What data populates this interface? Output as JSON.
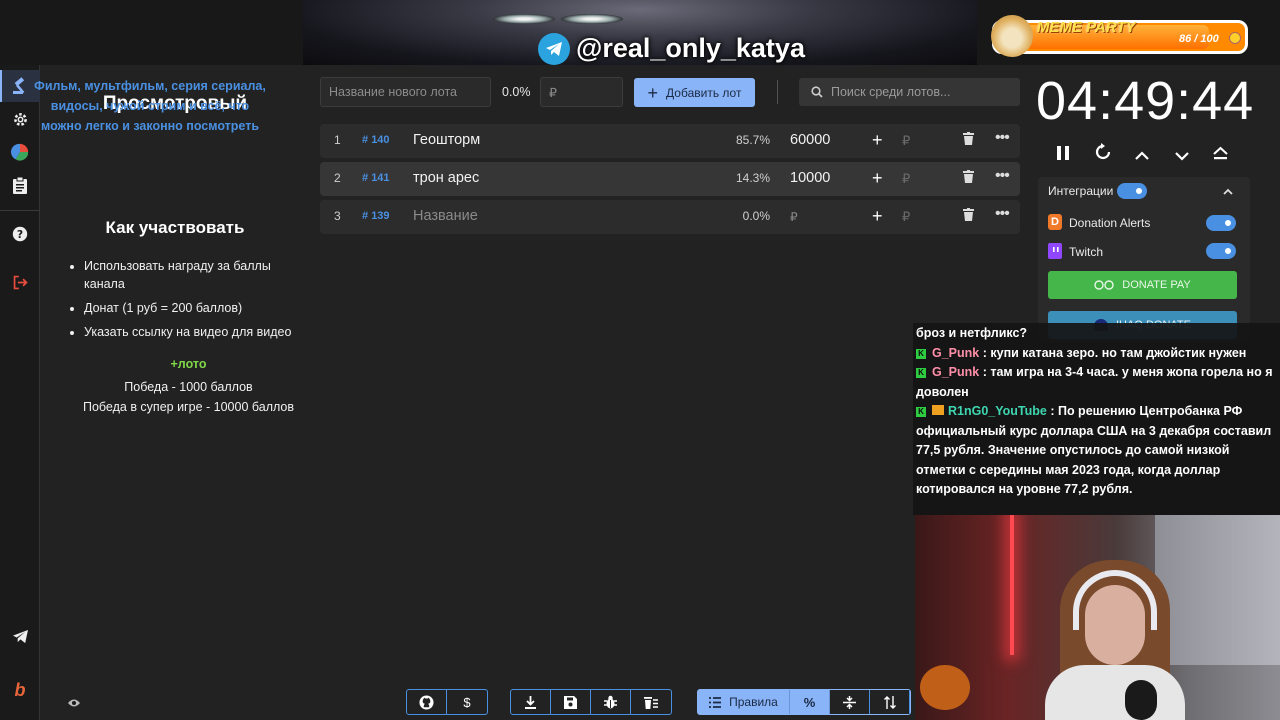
{
  "stream": {
    "channel": "@real_only_katya",
    "meme_party": {
      "title": "MEME PARTY",
      "count": "86 / 100",
      "progress": 0.86
    }
  },
  "sidebar": {
    "items": [
      {
        "name": "auction-icon",
        "glyph": "🔨"
      },
      {
        "name": "gear-icon",
        "glyph": "⚙"
      },
      {
        "name": "pie-chart-icon",
        "glyph": "◕"
      },
      {
        "name": "clipboard-icon",
        "glyph": "📋"
      },
      {
        "name": "help-icon",
        "glyph": "?"
      },
      {
        "name": "logout-icon",
        "glyph": "⇥"
      }
    ],
    "bottom": [
      {
        "name": "telegram-icon",
        "glyph": "➤"
      },
      {
        "name": "brand-icon",
        "glyph": "b"
      }
    ]
  },
  "info": {
    "title": "Просмотровый",
    "description": "Фильм, мультфильм, серия сериала, видосы, чужой стрим и всё, что можно легко и законно посмотреть",
    "how_title": "Как участвовать",
    "ways": [
      "Использовать награду за баллы канала",
      "Донат (1 руб = 200 баллов)",
      "Указать ссылку на видео для видео"
    ],
    "loto": "+лото",
    "prize1": "Победа - 1000 баллов",
    "prize2": "Победа в супер игре - 10000 баллов"
  },
  "lot_form": {
    "name_placeholder": "Название нового лота",
    "percent": "0.0%",
    "amount_placeholder": "₽",
    "add_label": "Добавить лот",
    "search_placeholder": "Поиск среди лотов..."
  },
  "lots": [
    {
      "index": "1",
      "id": "140",
      "name": "Геошторм",
      "percent": "85.7%",
      "amount": "60000",
      "rub": "₽"
    },
    {
      "index": "2",
      "id": "141",
      "name": "трон арес",
      "percent": "14.3%",
      "amount": "10000",
      "rub": "₽"
    },
    {
      "index": "3",
      "id": "139",
      "name": "Название",
      "percent": "0.0%",
      "amount": "₽",
      "rub": "₽"
    }
  ],
  "timer": {
    "time": "04:49:44"
  },
  "integrations": {
    "label": "Интеграции",
    "donation_alerts": "Donation Alerts",
    "twitch": "Twitch",
    "donate_pay": "DONATE PAY",
    "ihaq": "IHAQ DONATE"
  },
  "chat": [
    {
      "user": "",
      "text": "броз и нетфликс?",
      "badge": ""
    },
    {
      "user": "G_Punk",
      "text": " : купи катана зеро. но там джойстик нужен",
      "badge": "K"
    },
    {
      "user": "G_Punk",
      "text": " : там игра на 3-4 часа. у меня жопа горела но я доволен",
      "badge": "K"
    },
    {
      "user": "R1nG0_YouTube",
      "text": " : По решению Центробанка РФ официальный курс доллара США на 3 декабря составил 77,5 рубля. Значение опустилось до самой низкой отметки с середины мая 2023 года, когда доллар котировался на уровне 77,2 рубля.",
      "badge": "K"
    }
  ],
  "bottom_toolbar": {
    "rules_label": "Правила"
  },
  "colors": {
    "accent": "#8ab4f8",
    "link": "#4a90e2",
    "loto": "#7fd648",
    "donate_pay": "#45b649"
  }
}
